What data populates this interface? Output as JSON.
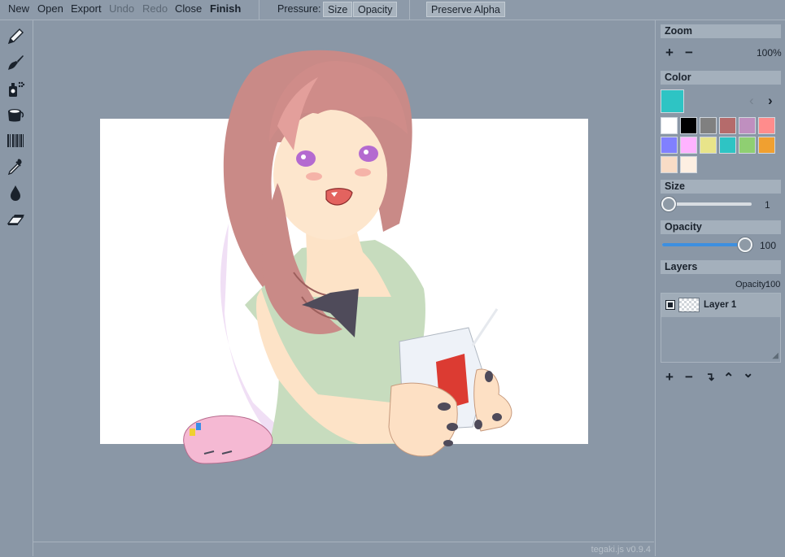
{
  "menu": {
    "new": "New",
    "open": "Open",
    "export": "Export",
    "undo": "Undo",
    "redo": "Redo",
    "close": "Close",
    "finish": "Finish",
    "pressure_label": "Pressure:",
    "pressure_size": "Size",
    "pressure_opacity": "Opacity",
    "preserve_alpha": "Preserve Alpha"
  },
  "tools": [
    "pencil-icon",
    "brush-icon",
    "airbrush-icon",
    "bucket-icon",
    "pattern-icon",
    "eyedropper-icon",
    "blur-icon",
    "eraser-icon"
  ],
  "panel": {
    "zoom": {
      "title": "Zoom",
      "plus": "+",
      "minus": "−",
      "value": "100%"
    },
    "color": {
      "title": "Color",
      "current": "#2ec4c4",
      "prev": "‹",
      "next": "›",
      "palette": [
        "#ffffff",
        "#000000",
        "#808080",
        "#b56b6b",
        "#bf8fbf",
        "#ff8c8c",
        "#8080ff",
        "#ffb3ff",
        "#e8e48a",
        "#2ec4c4",
        "#8fcf72",
        "#f0a030",
        "#f8dcc6",
        "#fdefe2"
      ]
    },
    "size": {
      "title": "Size",
      "value": "1",
      "level": 0.01
    },
    "opacity": {
      "title": "Opacity",
      "value": "100",
      "level": 1.0
    },
    "layers": {
      "title": "Layers",
      "opacity_label": "Opacity:",
      "opacity_value": "100",
      "items": [
        {
          "name": "Layer 1",
          "visible": true
        }
      ],
      "buttons": [
        "+",
        "−",
        "↴",
        "⌃",
        "⌄"
      ]
    }
  },
  "version": "tegaki.js v0.9.4"
}
